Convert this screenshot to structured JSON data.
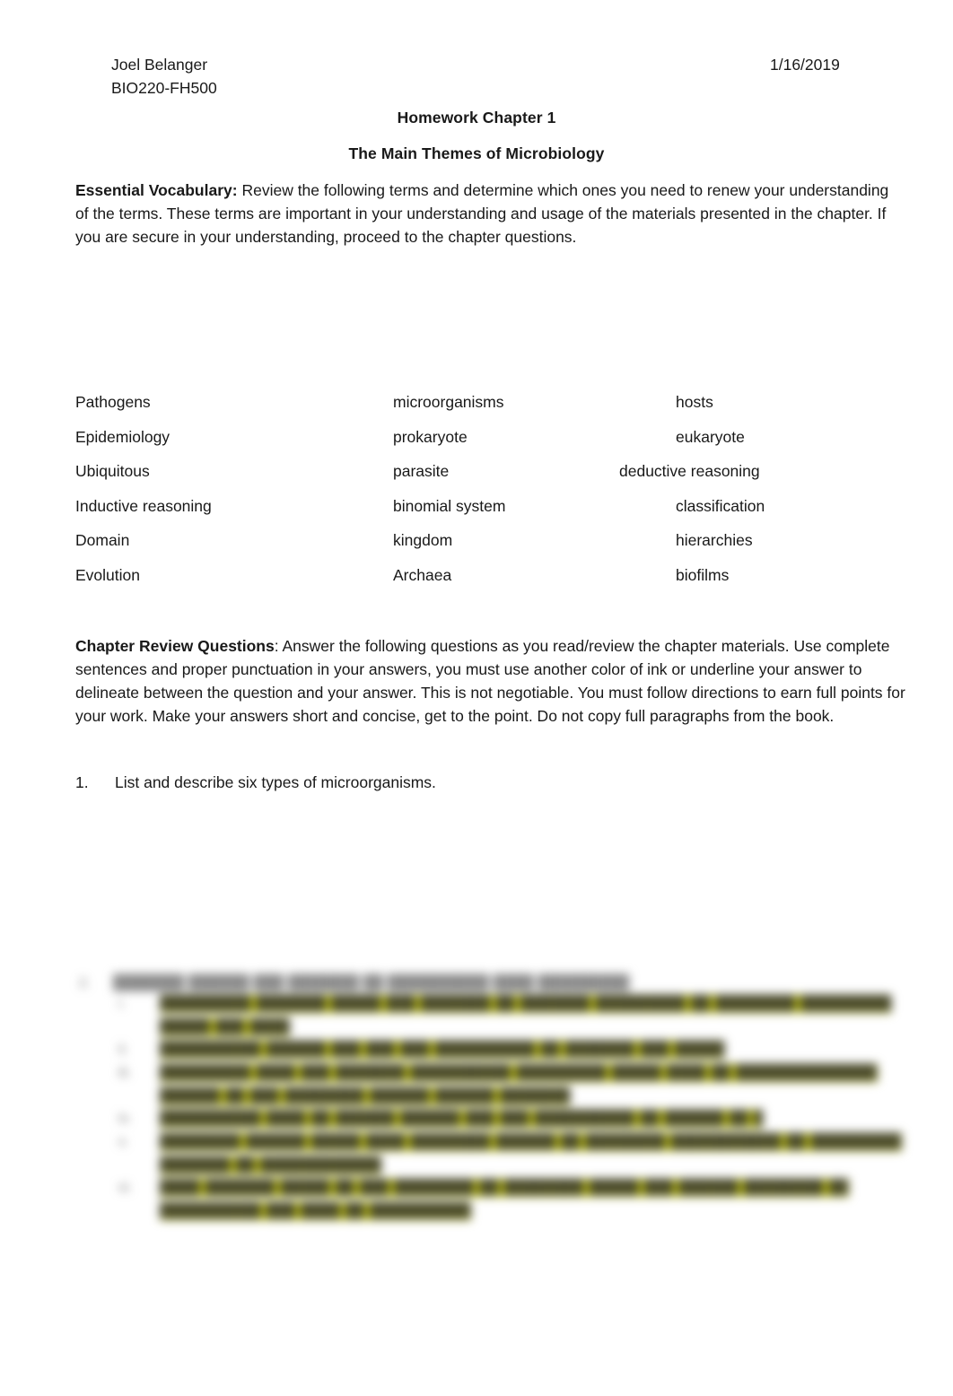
{
  "document": {
    "header": {
      "student_name": "Joel Belanger",
      "course_code": "BIO220-FH500",
      "date": "1/16/2019"
    },
    "titles": {
      "line1": "Homework Chapter 1",
      "line2": "The Main Themes of Microbiology"
    },
    "essential_vocabulary": {
      "label": "Essential Vocabulary:",
      "instructions": "  Review the following terms and determine which ones you need to renew your understanding of the terms. These terms are important in your understanding and usage of the materials presented in the chapter. If you are secure in your understanding, proceed to the chapter questions.",
      "terms_rows": [
        [
          "Pathogens",
          "microorganisms",
          "hosts"
        ],
        [
          "Epidemiology",
          "prokaryote",
          "eukaryote"
        ],
        [
          "Ubiquitous",
          "parasite",
          "deductive reasoning"
        ],
        [
          "Inductive reasoning",
          "binomial system",
          "classification"
        ],
        [
          "Domain",
          "kingdom",
          "hierarchies"
        ],
        [
          "Evolution",
          "Archaea",
          "biofilms"
        ]
      ]
    },
    "chapter_review": {
      "label": "Chapter Review Questions",
      "instructions": ": Answer the following questions as you read/review the chapter materials. Use complete sentences and proper punctuation in your answers, you must use another color of ink or underline your answer to delineate between the question and your answer. This is not negotiable. You must follow directions to earn full points for your work. Make your answers short and concise, get to the point. Do not copy full paragraphs from the book.",
      "questions": [
        {
          "number": "1.",
          "text": "List and describe six types of microorganisms."
        }
      ]
    },
    "blurred_answer_block": {
      "note": "illegible — blurred in source image",
      "marker": "2.",
      "heading": "███████ ██████ ███ ███████ ██ ██████████ ████ █████████",
      "items": [
        {
          "marker": "i.",
          "text": "█████████ ███████ █████ ███ ███████ ██ ███████ █████████ ██ ████████ █████████ █████ ███ ████"
        },
        {
          "marker": "ii.",
          "text": "██████████ ██████ ███ ███ ███ ██████████ ██ ███████ ███ █████"
        },
        {
          "marker": "iii.",
          "text": "█████████ ████ ███ ███████ ██████████ █████████ █████ ████ ██ ██████████████ ██████ ██ ███ ████████ ██████ ██████ ███████"
        },
        {
          "marker": "iv.",
          "text": "██████████ ████ ██ ██████ ██████ ███ ███ ██████████ ██ ██████ ██ █ █████"
        },
        {
          "marker": "v.",
          "text": "████████ ██████ █████ ████ ████████ ██████ ██ ████████ ███████████ ██ █████████ ███████ ██ ████████████"
        },
        {
          "marker": "vi.",
          "text": "████ ███████ █████ ██ ███ ████████ ██ ████████ █████ ███ ██████ ████████ ██ ██████████ ███ ████ ██ ██████████"
        }
      ]
    },
    "colors": {
      "highlight_yellow": "#e4e600",
      "page_background": "#ffffff",
      "body_text": "#191919"
    }
  }
}
